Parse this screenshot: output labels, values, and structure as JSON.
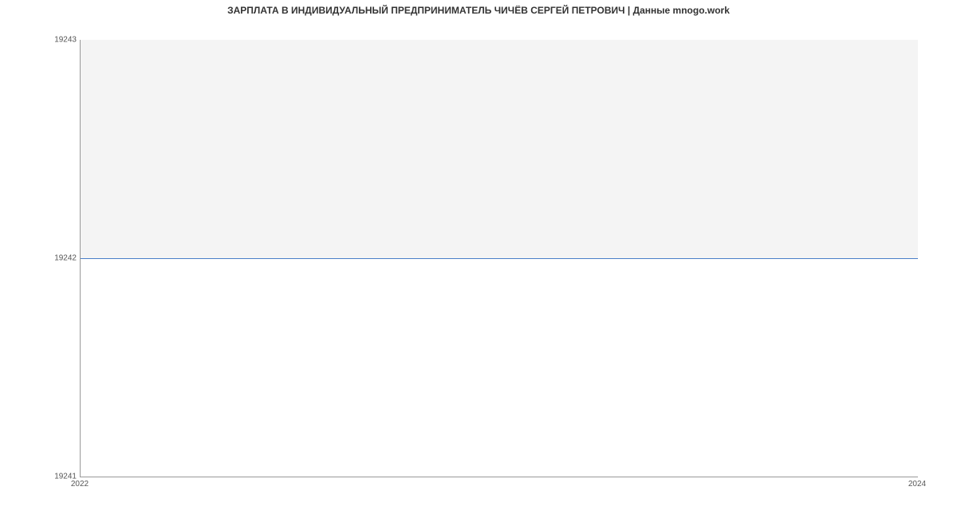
{
  "chart_data": {
    "type": "area",
    "title": "ЗАРПЛАТА В ИНДИВИДУАЛЬНЫЙ ПРЕДПРИНИМАТЕЛЬ ЧИЧЁВ СЕРГЕЙ ПЕТРОВИЧ | Данные mnogo.work",
    "xlabel": "",
    "ylabel": "",
    "x": [
      2022,
      2024
    ],
    "series": [
      {
        "name": "salary",
        "values": [
          19242,
          19242
        ],
        "color": "#4a7ec8",
        "fill": "#f4f4f4"
      }
    ],
    "xlim": [
      2022,
      2024
    ],
    "ylim": [
      19241,
      19243
    ],
    "y_ticks": [
      19241,
      19242,
      19243
    ],
    "x_ticks": [
      2022,
      2024
    ]
  }
}
